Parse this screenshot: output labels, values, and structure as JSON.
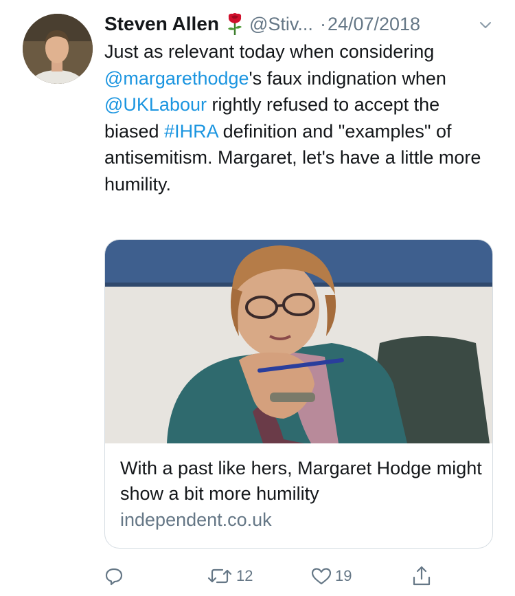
{
  "tweet": {
    "name": "Steven Allen",
    "handle": "@Stiv...",
    "separator": "·",
    "date": "24/07/2018",
    "text": {
      "p1": "Just as relevant today when considering ",
      "m1": "@margarethodge",
      "p2": "'s faux indignation when ",
      "m2": "@UKLabour",
      "p3": " rightly refused to accept the biased ",
      "h1": "#IHRA",
      "p4": " definition and \"examples\" of antisemitism. Margaret, let's have a little more humility."
    },
    "link_color": "#1b95e0"
  },
  "card": {
    "title": "With a past like hers, Margaret Hodge might show a bit more humility",
    "domain": "independent.co.uk"
  },
  "actions": {
    "reply_icon": "reply-icon",
    "retweet_icon": "retweet-icon",
    "retweet_count": "12",
    "like_icon": "heart-icon",
    "like_count": "19",
    "share_icon": "share-icon"
  },
  "colors": {
    "text": "#14171a",
    "muted": "#657786",
    "border": "#d6dde3"
  }
}
